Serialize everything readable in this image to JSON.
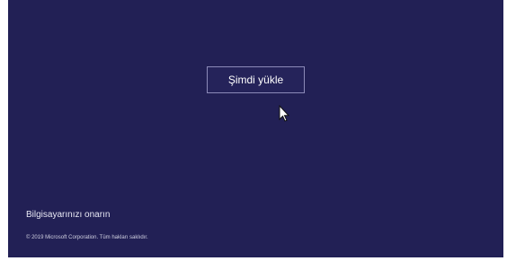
{
  "setup": {
    "install_button_label": "Şimdi yükle",
    "repair_link_label": "Bilgisayarınızı onarın",
    "copyright_text": "© 2019 Microsoft Corporation. Tüm hakları saklıdır."
  },
  "colors": {
    "background": "#222055",
    "button_border": "#8c8ab8",
    "text": "#ffffff"
  },
  "icons": {
    "pointer": "mouse-pointer-icon"
  }
}
